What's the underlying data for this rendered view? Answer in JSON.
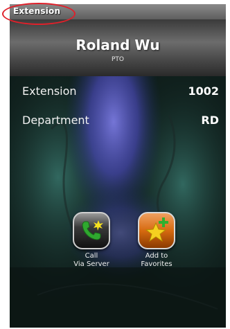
{
  "titlebar": {
    "title": "Extension"
  },
  "contact": {
    "name": "Roland Wu",
    "title": "PTO"
  },
  "details": [
    {
      "label": "Extension",
      "value": "1002"
    },
    {
      "label": "Department",
      "value": "RD"
    }
  ],
  "actions": {
    "call": {
      "line1": "Call",
      "line2": "Via Server",
      "icon": "phone-icon"
    },
    "favorite": {
      "line1": "Add to",
      "line2": "Favorites",
      "icon": "star-plus-icon"
    }
  },
  "colors": {
    "annotation": "#e0202a",
    "call_button": "#2a2a2a",
    "favorite_button": "#d66a10",
    "phone_glyph": "#2fa82f",
    "star_glyph": "#f5d020"
  }
}
